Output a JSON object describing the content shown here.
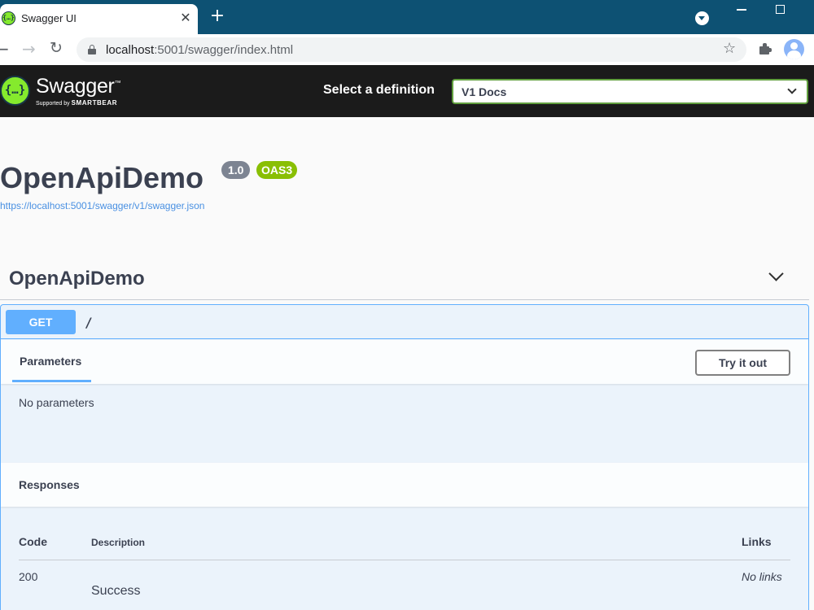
{
  "browser": {
    "tab_title": "Swagger UI",
    "tab_close": "✕",
    "new_tab": "+",
    "url_host": "localhost",
    "url_rest": ":5001/swagger/index.html",
    "star": "☆",
    "back": "←",
    "forward": "→",
    "reload": "↻"
  },
  "topbar": {
    "logo_glyph": "{…}",
    "brand": "Swagger",
    "brand_mark": "™",
    "supported_by": "Supported by",
    "smartbear": "SMARTBEAR",
    "definition_label": "Select a definition",
    "definition_selected": "V1 Docs"
  },
  "info": {
    "title": "OpenApiDemo",
    "version": "1.0",
    "oas": "OAS3",
    "spec_url": "https://localhost:5001/swagger/v1/swagger.json"
  },
  "tag": {
    "name": "OpenApiDemo"
  },
  "operation": {
    "method": "GET",
    "path": "/",
    "parameters_tab": "Parameters",
    "try_it_out": "Try it out",
    "no_parameters": "No parameters",
    "responses_heading": "Responses",
    "columns": {
      "code": "Code",
      "description": "Description",
      "links": "Links"
    },
    "responses": [
      {
        "code": "200",
        "description": "Success",
        "links": "No links"
      }
    ]
  },
  "colors": {
    "get_method": "#61affe",
    "swagger_green": "#85ea2d",
    "oas_badge": "#89bf04",
    "version_badge": "#7d8492",
    "topbar": "#1b1b1b",
    "browser_frame": "#0d5173"
  }
}
